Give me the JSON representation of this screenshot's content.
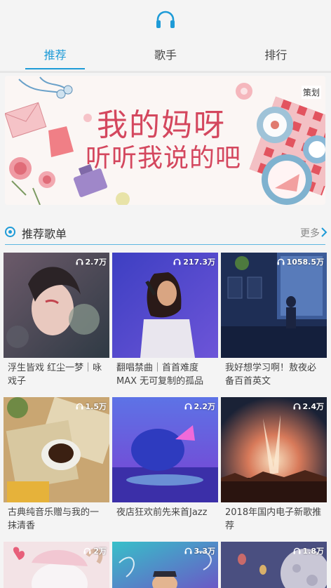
{
  "tabs": [
    {
      "label": "推荐",
      "active": true
    },
    {
      "label": "歌手",
      "active": false
    },
    {
      "label": "排行",
      "active": false
    }
  ],
  "banner": {
    "tag": "策划",
    "title_line1": "我的妈呀",
    "title_line2": "听听我说的吧",
    "dot_count": 5,
    "active_dot": 2
  },
  "section": {
    "title": "推荐歌单",
    "more": "更多"
  },
  "playlists": [
    {
      "plays": "2.7万",
      "name": "浮生皆戏 红尘一梦｜咏戏子"
    },
    {
      "plays": "217.3万",
      "name": "翻唱禁曲｜首首难度MAX 无可复制的孤品"
    },
    {
      "plays": "1058.5万",
      "name": "我好想学习啊！敖夜必备百首英文"
    },
    {
      "plays": "1.5万",
      "name": "古典纯音乐赠与我的一抹清香"
    },
    {
      "plays": "2.2万",
      "name": "夜店狂欢前先来首Jazz"
    },
    {
      "plays": "2.4万",
      "name": "2018年国内电子新歌推荐"
    },
    {
      "plays": "2万",
      "name": ""
    },
    {
      "plays": "3.3万",
      "name": ""
    },
    {
      "plays": "1.8万",
      "name": ""
    }
  ],
  "colors": {
    "accent": "#1e9bd7",
    "banner_text": "#d4475e"
  }
}
